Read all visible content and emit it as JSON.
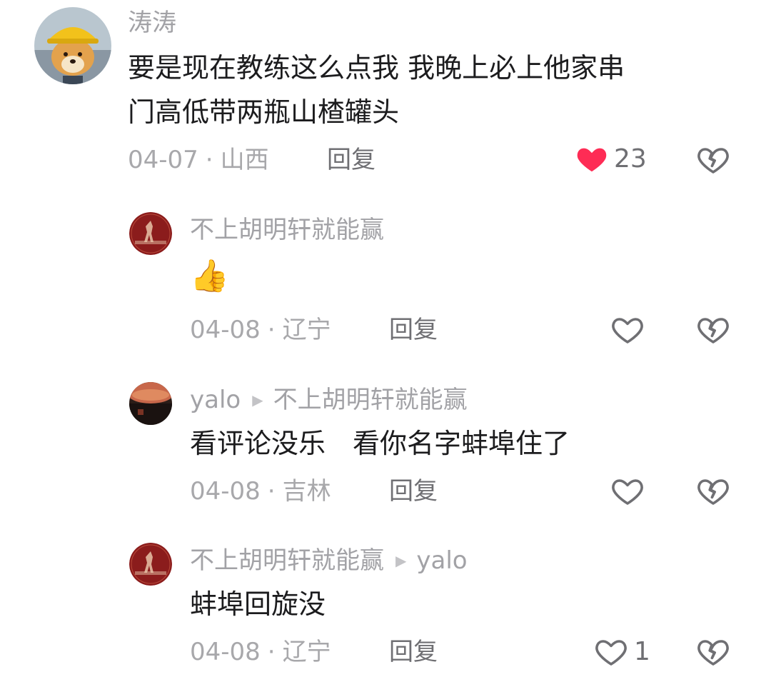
{
  "comments": [
    {
      "author": "涛涛",
      "text_line1": "要是现在教练这么点我 我晚上必上他家串",
      "text_line2": "门高低带两瓶山楂罐头",
      "date": "04-07",
      "region": "山西",
      "reply_label": "回复",
      "like_count": "23",
      "liked": true
    },
    {
      "author": "不上胡明轩就能赢",
      "text": "👍",
      "date": "04-08",
      "region": "辽宁",
      "reply_label": "回复",
      "like_count": "",
      "liked": false
    },
    {
      "author": "yalo",
      "reply_to": "不上胡明轩就能赢",
      "text": "看评论没乐　看你名字蚌埠住了",
      "date": "04-08",
      "region": "吉林",
      "reply_label": "回复",
      "like_count": "",
      "liked": false
    },
    {
      "author": "不上胡明轩就能赢",
      "reply_to": "yalo",
      "text": "蚌埠回旋没",
      "date": "04-08",
      "region": "辽宁",
      "reply_label": "回复",
      "like_count": "1",
      "liked": false
    }
  ],
  "separator": "·",
  "reply_arrow": "▶",
  "colors": {
    "liked_heart": "#fe2c55",
    "icon_stroke": "#6f6f73",
    "username": "#a2a2a6",
    "body_text": "#1c1c1e"
  },
  "icons": {
    "like": "heart-icon",
    "dislike": "broken-heart-icon",
    "reply_arrow": "triangle-right-icon"
  }
}
